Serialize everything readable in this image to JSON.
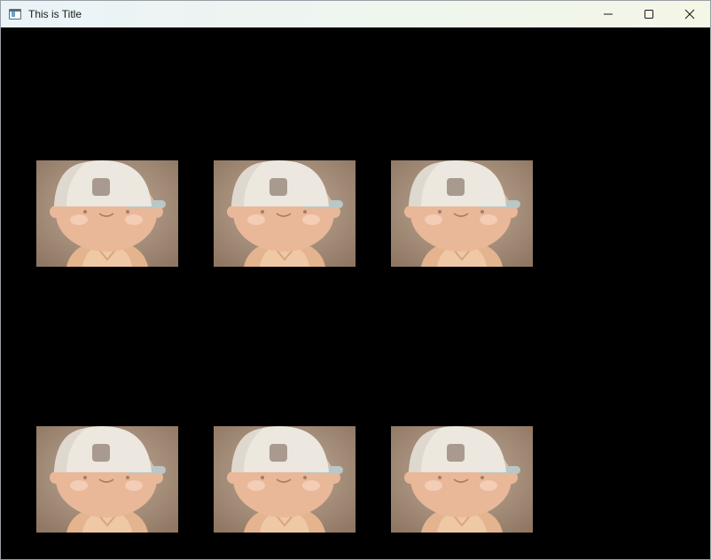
{
  "window": {
    "title": "This is Title",
    "app_icon": "window-app-icon",
    "controls": {
      "minimize_icon": "minimize-icon",
      "maximize_icon": "maximize-icon",
      "close_icon": "close-icon"
    }
  },
  "canvas": {
    "background": "#000000",
    "tile_rows": 2,
    "tile_columns": 3,
    "tile_image": "cartoon-boy-with-cap-image"
  },
  "colors": {
    "titlebar_start": "#eaf3f8",
    "titlebar_end": "#f4f6e6",
    "tile_background": "#b09a87",
    "cap": "#ece7df",
    "skin": "#e9b899"
  }
}
